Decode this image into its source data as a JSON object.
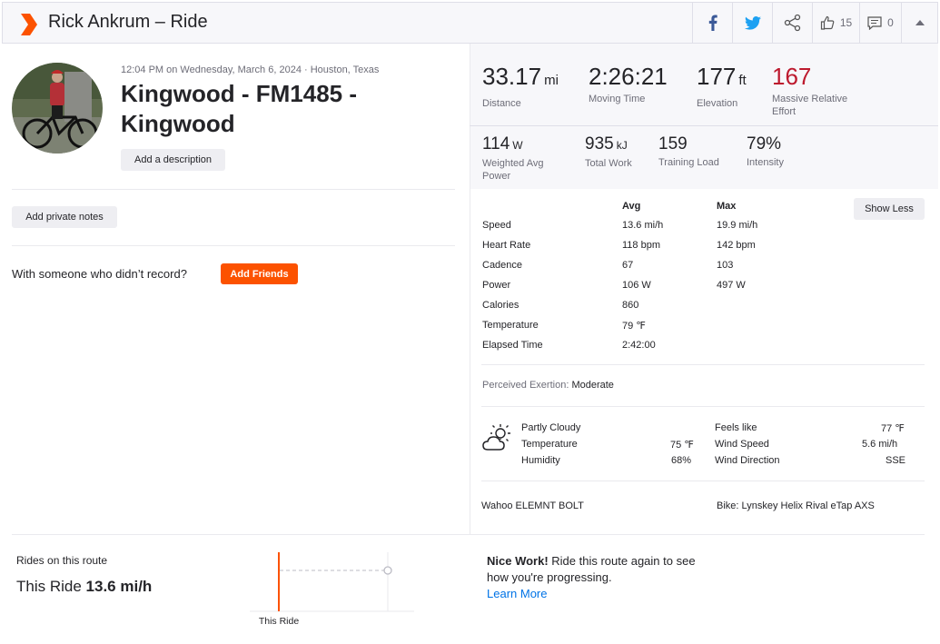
{
  "header": {
    "title": "Rick Ankrum – Ride",
    "kudos_count": "15",
    "comment_count": "0"
  },
  "activity": {
    "meta": "12:04 PM on Wednesday, March 6, 2024 · Houston, Texas",
    "title": "Kingwood - FM1485 - Kingwood",
    "add_description_label": "Add a description",
    "private_notes_label": "Add private notes",
    "with_someone_text": "With someone who didn’t record?",
    "add_friends_label": "Add Friends"
  },
  "primary_stats": [
    {
      "value": "33.17",
      "unit": "mi",
      "label": "Distance"
    },
    {
      "value": "2:26:21",
      "unit": "",
      "label": "Moving Time"
    },
    {
      "value": "177",
      "unit": "ft",
      "label": "Elevation"
    },
    {
      "value": "167",
      "unit": "",
      "label": "Massive Relative Effort"
    }
  ],
  "secondary_stats": [
    {
      "value": "114",
      "unit": "W",
      "label": "Weighted Avg Power"
    },
    {
      "value": "935",
      "unit": "kJ",
      "label": "Total Work"
    },
    {
      "value": "159",
      "unit": "",
      "label": "Training Load"
    },
    {
      "value": "79%",
      "unit": "",
      "label": "Intensity"
    }
  ],
  "more_stats": {
    "avg_header": "Avg",
    "max_header": "Max",
    "show_less_label": "Show Less",
    "rows": [
      {
        "label": "Speed",
        "avg": "13.6 mi/h",
        "max": "19.9 mi/h"
      },
      {
        "label": "Heart Rate",
        "avg": "118 bpm",
        "max": "142 bpm"
      },
      {
        "label": "Cadence",
        "avg": "67",
        "max": "103"
      },
      {
        "label": "Power",
        "avg": "106 W",
        "max": "497 W"
      },
      {
        "label": "Calories",
        "avg": "860",
        "max": ""
      },
      {
        "label": "Temperature",
        "avg": "79 ℉",
        "max": ""
      },
      {
        "label": "Elapsed Time",
        "avg": "2:42:00",
        "max": ""
      }
    ]
  },
  "perceived": {
    "label": "Perceived Exertion:",
    "value": "Moderate"
  },
  "weather": {
    "condition": "Partly Cloudy",
    "temperature_label": "Temperature",
    "temperature_value": "75 ℉",
    "humidity_label": "Humidity",
    "humidity_value": "68%",
    "feels_like_label": "Feels like",
    "feels_like_value": "77 ℉",
    "wind_speed_label": "Wind Speed",
    "wind_speed_value": "5.6 mi/h",
    "wind_direction_label": "Wind Direction",
    "wind_direction_value": "SSE"
  },
  "device": "Wahoo ELEMNT BOLT",
  "bike": "Bike: Lynskey Helix Rival eTap AXS",
  "rides_on_route": {
    "title": "Rides on this route",
    "this_ride_label": "This Ride",
    "this_ride_value": "13.6 mi/h",
    "chart_label": "This Ride",
    "nice_bold": "Nice Work!",
    "nice_text": " Ride this route again to see how you're progressing.",
    "learn_more": "Learn More"
  },
  "colors": {
    "brand": "#fc5200",
    "effort": "#bd1a2e",
    "link": "#0073e6"
  }
}
